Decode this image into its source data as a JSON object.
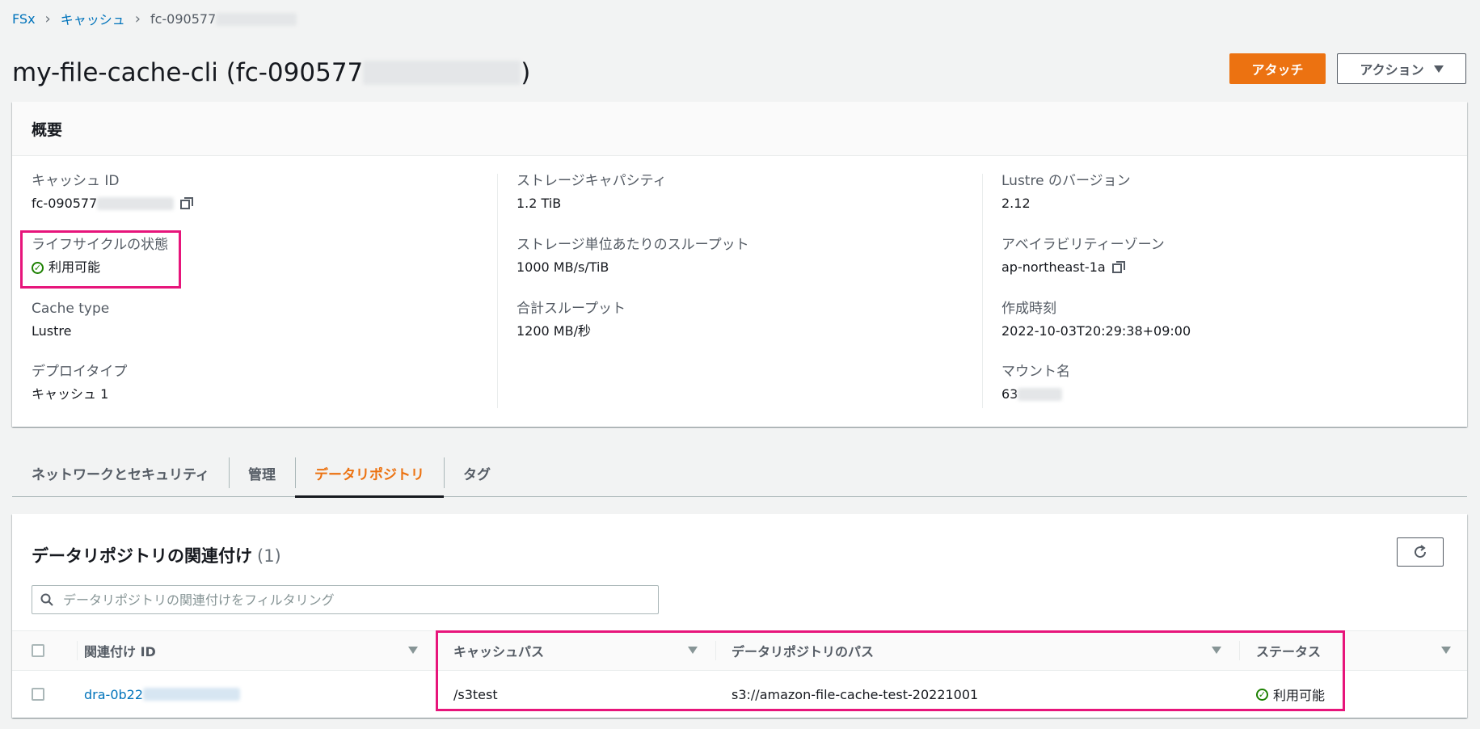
{
  "breadcrumb": {
    "root": "FSx",
    "section": "キャッシュ",
    "current": "fc-090577"
  },
  "header": {
    "title_prefix": "my-file-cache-cli (fc-090577",
    "title_suffix": ")",
    "attach_label": "アタッチ",
    "actions_label": "アクション"
  },
  "summary": {
    "heading": "概要",
    "fields": {
      "cache_id": {
        "label": "キャッシュ ID",
        "value": "fc-090577"
      },
      "lifecycle": {
        "label": "ライフサイクルの状態",
        "value": "利用可能"
      },
      "cache_type": {
        "label": "Cache type",
        "value": "Lustre"
      },
      "deploy_type": {
        "label": "デプロイタイプ",
        "value": "キャッシュ 1"
      },
      "storage_capacity": {
        "label": "ストレージキャパシティ",
        "value": "1.2 TiB"
      },
      "throughput_per_unit": {
        "label": "ストレージ単位あたりのスループット",
        "value": "1000 MB/s/TiB"
      },
      "total_throughput": {
        "label": "合計スループット",
        "value": "1200 MB/秒"
      },
      "lustre_version": {
        "label": "Lustre のバージョン",
        "value": "2.12"
      },
      "availability_zone": {
        "label": "アベイラビリティーゾーン",
        "value": "ap-northeast-1a"
      },
      "created_at": {
        "label": "作成時刻",
        "value": "2022-10-03T20:29:38+09:00"
      },
      "mount_name": {
        "label": "マウント名",
        "value": "63"
      }
    }
  },
  "tabs": [
    {
      "label": "ネットワークとセキュリティ"
    },
    {
      "label": "管理"
    },
    {
      "label": "データリポジトリ"
    },
    {
      "label": "タグ"
    }
  ],
  "repository": {
    "title": "データリポジトリの関連付け",
    "count": "(1)",
    "filter_placeholder": "データリポジトリの関連付けをフィルタリング",
    "columns": {
      "id": "関連付け ID",
      "cache_path": "キャッシュパス",
      "repo_path": "データリポジトリのパス",
      "status": "ステータス"
    },
    "rows": [
      {
        "id": "dra-0b22",
        "cache_path": "/s3test",
        "repo_path": "s3://amazon-file-cache-test-20221001",
        "status": "利用可能"
      }
    ]
  },
  "colors": {
    "accent": "#ec7211",
    "link": "#0073bb",
    "success": "#1d8102",
    "highlight": "#e7157b"
  }
}
